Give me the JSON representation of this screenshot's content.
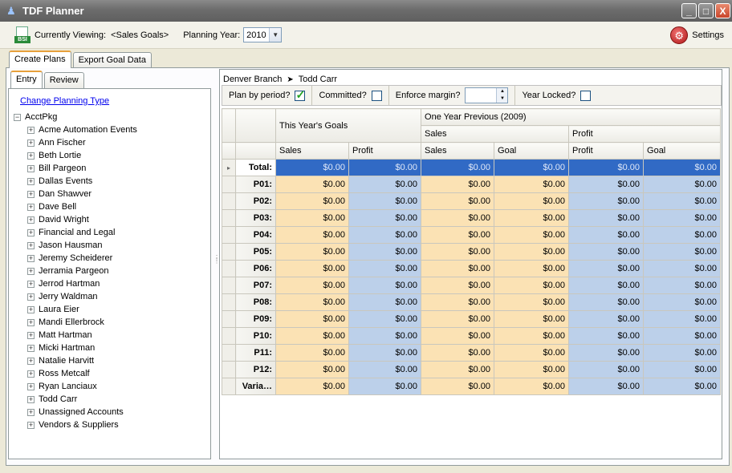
{
  "window": {
    "title": "TDF Planner",
    "min": "_",
    "max": "□",
    "close": "X"
  },
  "toolbar": {
    "currently_viewing_label": "Currently Viewing:",
    "currently_viewing_value": "<Sales Goals>",
    "planning_year_label": "Planning Year:",
    "planning_year_value": "2010",
    "settings_label": "Settings",
    "bsi_badge": "BSI"
  },
  "outer_tabs": [
    {
      "label": "Create Plans",
      "active": true
    },
    {
      "label": "Export Goal Data",
      "active": false
    }
  ],
  "inner_tabs": [
    {
      "label": "Entry",
      "active": true
    },
    {
      "label": "Review",
      "active": false
    }
  ],
  "left": {
    "change_type_link": "Change Planning Type",
    "root": "AcctPkg",
    "items": [
      "Acme Automation Events",
      "Ann Fischer",
      "Beth Lortie",
      "Bill Pargeon",
      "Dallas Events",
      "Dan Shawver",
      "Dave Bell",
      "David Wright",
      "Financial and Legal",
      "Jason Hausman",
      "Jeremy Scheiderer",
      "Jerramia Pargeon",
      "Jerrod Hartman",
      "Jerry Waldman",
      "Laura Eier",
      "Mandi Ellerbrock",
      "Matt Hartman",
      "Micki Hartman",
      "Natalie Harvitt",
      "Ross Metcalf",
      "Ryan Lanciaux",
      "Todd Carr",
      "Unassigned Accounts",
      "Vendors & Suppliers"
    ]
  },
  "breadcrumb": {
    "branch": "Denver Branch",
    "person": "Todd Carr"
  },
  "options": {
    "plan_by_period": "Plan by period?",
    "plan_by_period_checked": true,
    "committed": "Committed?",
    "committed_checked": false,
    "enforce_margin": "Enforce margin?",
    "enforce_margin_value": "",
    "year_locked": "Year Locked?",
    "year_locked_checked": false
  },
  "grid": {
    "group1": "This Year's Goals",
    "group2": "One Year Previous (2009)",
    "sub_sales": "Sales",
    "sub_profit": "Profit",
    "columns": [
      "Sales",
      "Profit",
      "Sales",
      "Goal",
      "Profit",
      "Goal"
    ],
    "rows": [
      {
        "label": "Total:",
        "values": [
          "$0.00",
          "$0.00",
          "$0.00",
          "$0.00",
          "$0.00",
          "$0.00"
        ]
      },
      {
        "label": "P01:",
        "values": [
          "$0.00",
          "$0.00",
          "$0.00",
          "$0.00",
          "$0.00",
          "$0.00"
        ]
      },
      {
        "label": "P02:",
        "values": [
          "$0.00",
          "$0.00",
          "$0.00",
          "$0.00",
          "$0.00",
          "$0.00"
        ]
      },
      {
        "label": "P03:",
        "values": [
          "$0.00",
          "$0.00",
          "$0.00",
          "$0.00",
          "$0.00",
          "$0.00"
        ]
      },
      {
        "label": "P04:",
        "values": [
          "$0.00",
          "$0.00",
          "$0.00",
          "$0.00",
          "$0.00",
          "$0.00"
        ]
      },
      {
        "label": "P05:",
        "values": [
          "$0.00",
          "$0.00",
          "$0.00",
          "$0.00",
          "$0.00",
          "$0.00"
        ]
      },
      {
        "label": "P06:",
        "values": [
          "$0.00",
          "$0.00",
          "$0.00",
          "$0.00",
          "$0.00",
          "$0.00"
        ]
      },
      {
        "label": "P07:",
        "values": [
          "$0.00",
          "$0.00",
          "$0.00",
          "$0.00",
          "$0.00",
          "$0.00"
        ]
      },
      {
        "label": "P08:",
        "values": [
          "$0.00",
          "$0.00",
          "$0.00",
          "$0.00",
          "$0.00",
          "$0.00"
        ]
      },
      {
        "label": "P09:",
        "values": [
          "$0.00",
          "$0.00",
          "$0.00",
          "$0.00",
          "$0.00",
          "$0.00"
        ]
      },
      {
        "label": "P10:",
        "values": [
          "$0.00",
          "$0.00",
          "$0.00",
          "$0.00",
          "$0.00",
          "$0.00"
        ]
      },
      {
        "label": "P11:",
        "values": [
          "$0.00",
          "$0.00",
          "$0.00",
          "$0.00",
          "$0.00",
          "$0.00"
        ]
      },
      {
        "label": "P12:",
        "values": [
          "$0.00",
          "$0.00",
          "$0.00",
          "$0.00",
          "$0.00",
          "$0.00"
        ]
      },
      {
        "label": "Varia…",
        "values": [
          "$0.00",
          "$0.00",
          "$0.00",
          "$0.00",
          "$0.00",
          "$0.00"
        ]
      }
    ]
  }
}
